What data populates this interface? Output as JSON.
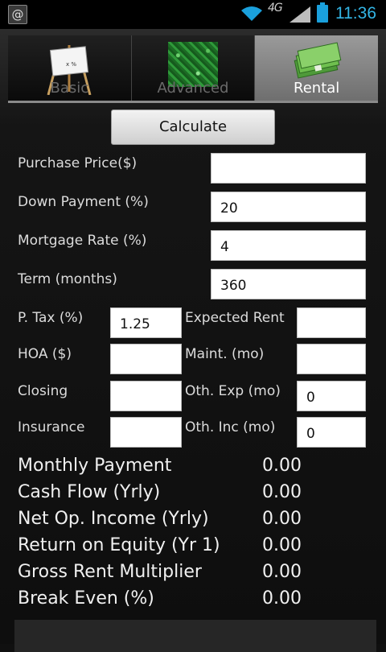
{
  "status_bar": {
    "network": "4G",
    "time": "11:36",
    "notif_glyph": "@"
  },
  "tabs": [
    {
      "label": "Basic",
      "icon": "easel-icon",
      "active": false
    },
    {
      "label": "Advanced",
      "icon": "texture-icon",
      "active": false
    },
    {
      "label": "Rental",
      "icon": "money-icon",
      "active": true
    }
  ],
  "calculate_label": "Calculate",
  "fields": {
    "purchase_price": {
      "label": "Purchase Price($)",
      "value": ""
    },
    "down_payment": {
      "label": "Down Payment (%)",
      "value": "20"
    },
    "mortgage_rate": {
      "label": "Mortgage Rate (%)",
      "value": "4"
    },
    "term": {
      "label": "Term (months)",
      "value": "360"
    },
    "p_tax": {
      "label": "P. Tax (%)",
      "value": "1.25"
    },
    "expected_rent": {
      "label": "Expected Rent",
      "value": ""
    },
    "hoa": {
      "label": "HOA ($)",
      "value": ""
    },
    "maint": {
      "label": "Maint. (mo)",
      "value": ""
    },
    "closing": {
      "label": "Closing",
      "value": ""
    },
    "oth_exp": {
      "label": "Oth. Exp (mo)",
      "value": "0"
    },
    "insurance": {
      "label": "Insurance",
      "value": ""
    },
    "oth_inc": {
      "label": "Oth. Inc (mo)",
      "value": "0"
    }
  },
  "results": [
    {
      "label": "Monthly Payment",
      "value": "0.00"
    },
    {
      "label": "Cash Flow (Yrly)",
      "value": "0.00"
    },
    {
      "label": "Net Op. Income (Yrly)",
      "value": "0.00"
    },
    {
      "label": "Return on Equity (Yr 1)",
      "value": "0.00"
    },
    {
      "label": "Gross Rent Multiplier",
      "value": "0.00"
    },
    {
      "label": "Break Even (%)",
      "value": "0.00"
    }
  ]
}
